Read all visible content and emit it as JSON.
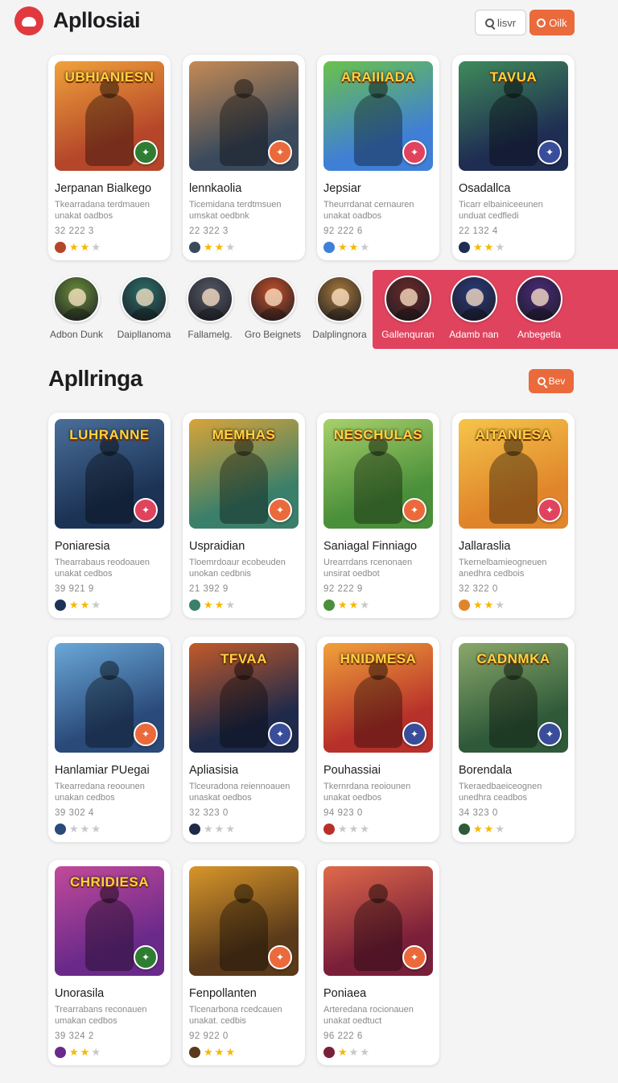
{
  "header": {
    "app_title": "Apllosiai",
    "search_button_label": "lisvr",
    "action_button_label": "Oilk"
  },
  "featured_cards": [
    {
      "caption": "UBHIANIESN",
      "title": "Jerpanan Bialkego",
      "desc": "Tkearradana terdmauen unakat oadbos",
      "stats": "32 222 3",
      "rating": 2,
      "bg": "#b5462a",
      "bg2": "#f0a23a",
      "badge_color": "#2f7d32"
    },
    {
      "caption": "",
      "title": "lennkaolia",
      "desc": "Ticemidana terdtmsuen umskat oedbnk",
      "stats": "22 322 3",
      "rating": 2,
      "bg": "#3a4a5c",
      "bg2": "#c48a55",
      "badge_color": "#ea6a3c"
    },
    {
      "caption": "ARAIIIADA",
      "title": "Jepsiar",
      "desc": "Theurrdanat cernauren unakat oadbos",
      "stats": "92 222 6",
      "rating": 2,
      "bg": "#3f7fd6",
      "bg2": "#6ac24a",
      "badge_color": "#e0435e"
    },
    {
      "caption": "TAVUA",
      "title": "Osadallca",
      "desc": "Ticarr elbainiceeunen unduat cedfledi",
      "stats": "22 132 4",
      "rating": 2,
      "bg": "#1f2d52",
      "bg2": "#3f8a5a",
      "badge_color": "#3a4d9a"
    }
  ],
  "avatars": [
    {
      "label": "Adbon Dunk",
      "color": "#6a8f3a"
    },
    {
      "label": "Daipllanoma",
      "color": "#2b6f6a"
    },
    {
      "label": "Fallamelg.",
      "color": "#555a66"
    },
    {
      "label": "Gro Beignets",
      "color": "#c2502a"
    },
    {
      "label": "Dalplingnora",
      "color": "#a87a3a"
    },
    {
      "label": "Gallenquran",
      "color": "#6a2a2a"
    },
    {
      "label": "Adamb nan",
      "color": "#2a3a7a"
    },
    {
      "label": "Anbegetla",
      "color": "#4a2a7a"
    }
  ],
  "section": {
    "title": "Apllringa",
    "button_label": "Bev"
  },
  "grid_cards": [
    {
      "caption": "LUHRANNE",
      "title": "Poniaresia",
      "desc": "Thearrabaus reodoauen unakat cedbos",
      "stats": "39 921 9",
      "rating": 2,
      "bg": "#1c3355",
      "bg2": "#4a6f9a",
      "badge_color": "#e0435e"
    },
    {
      "caption": "MEMHAS",
      "title": "Uspraidian",
      "desc": "Tloemrdoaur ecobeuden unokan cedbnis",
      "stats": "21 392 9",
      "rating": 2,
      "bg": "#3a7f6a",
      "bg2": "#d7a43a",
      "badge_color": "#ea6a3c"
    },
    {
      "caption": "NESCHULAS",
      "title": "Saniagal Finniago",
      "desc": "Urearrdans rcenonaen unsirat oedbot",
      "stats": "92 222 9",
      "rating": 2,
      "bg": "#4a8f3a",
      "bg2": "#a8d06a",
      "badge_color": "#ea6a3c"
    },
    {
      "caption": "AITANIESA",
      "title": "Jallaraslia",
      "desc": "Tkernelbamieogneuen anedhra cedbois",
      "stats": "32 322 0",
      "rating": 2,
      "bg": "#e0852a",
      "bg2": "#f5c54a",
      "badge_color": "#e0435e"
    },
    {
      "caption": "",
      "title": "Hanlamiar PUegai",
      "desc": "Tkearredana reoounen unakan cedbos",
      "stats": "39 302 4",
      "rating": 0,
      "bg": "#2a4a7a",
      "bg2": "#6aa8d8",
      "badge_color": "#ea6a3c"
    },
    {
      "caption": "TFVAA",
      "title": "Apliasisia",
      "desc": "Tlceuradona reiennoauen unaskat oedbos",
      "stats": "32 323 0",
      "rating": 0,
      "bg": "#1f2a4a",
      "bg2": "#c25a2a",
      "badge_color": "#3a4d9a"
    },
    {
      "caption": "HNIDMESA",
      "title": "Pouhassiai",
      "desc": "Tkernrdana reoiounen unakat oedbos",
      "stats": "94 923 0",
      "rating": 0,
      "bg": "#b8302a",
      "bg2": "#f0a23a",
      "badge_color": "#3a4d9a"
    },
    {
      "caption": "CADNMKA",
      "title": "Borendala",
      "desc": "Tkeraedbaeiceognen unedhra ceadbos",
      "stats": "34 323 0",
      "rating": 2,
      "bg": "#2f5a3a",
      "bg2": "#8aa86a",
      "badge_color": "#3a4d9a"
    },
    {
      "caption": "CHRIDIESA",
      "title": "Unorasila",
      "desc": "Trearrabans reconauen umakan cedbos",
      "stats": "39 324 2",
      "rating": 2,
      "bg": "#6a2a8a",
      "bg2": "#c24a9a",
      "badge_color": "#2f7d32"
    },
    {
      "caption": "",
      "title": "Fenpollanten",
      "desc": "Tlcenarbona rcedcauen unakat. cedbis",
      "stats": "92 922 0",
      "rating": 3,
      "bg": "#5a3a1a",
      "bg2": "#d8962a",
      "badge_color": "#ea6a3c"
    },
    {
      "caption": "",
      "title": "Poniaea",
      "desc": "Arteredana rocionauen unakat oedtuct",
      "stats": "96 222 6",
      "rating": 1,
      "bg": "#7a1f3a",
      "bg2": "#e06a4a",
      "badge_color": "#ea6a3c"
    }
  ],
  "colors": {
    "accent_orange": "#ea6a3c",
    "highlight_pink": "#e0435e",
    "star_on": "#f5b800",
    "star_off": "#c8c8cc"
  }
}
